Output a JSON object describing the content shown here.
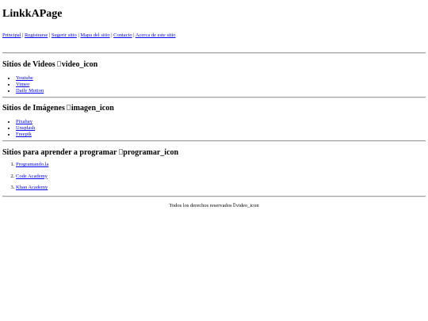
{
  "header": {
    "title": "LinkkAPage"
  },
  "nav": {
    "items": [
      {
        "label": "Principal"
      },
      {
        "label": "Registrarse"
      },
      {
        "label": "Sugerir sitio"
      },
      {
        "label": "Mapa del sitio"
      },
      {
        "label": "Contacto"
      },
      {
        "label": "Acerca de este sitio"
      }
    ],
    "separator": "|"
  },
  "sections": [
    {
      "title": "Sitios de Videos",
      "icon_alt": "video_icon",
      "links": [
        "Youtube",
        "Vimeo",
        "Daily Motion"
      ]
    },
    {
      "title": "Sitios de Imágenes",
      "icon_alt": "imagen_icon",
      "links": [
        "Pixabay",
        "Unsplash",
        "Freepik"
      ]
    },
    {
      "title": "Sitios para aprender a programar",
      "icon_alt": "programar_icon",
      "links": [
        "Programando.la",
        "Code Academy",
        "Khan Academy"
      ]
    }
  ],
  "footer": {
    "text": "Todos los derechos reservados",
    "icon_alt": "video_icon"
  }
}
